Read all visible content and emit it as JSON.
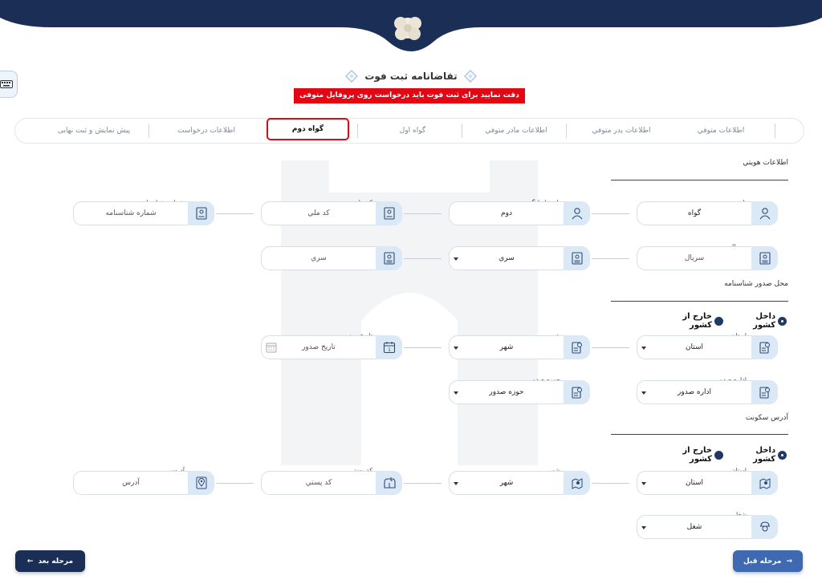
{
  "page": {
    "title": "تقاضانامه ثبت فوت",
    "warning": "دقت نمایید برای ثبت فوت باید درخواست روی پروفایل متوفی تقاضا داده شود"
  },
  "steps": [
    {
      "label": "اطلاعات متوفي"
    },
    {
      "label": "اطلاعات پدر متوفي"
    },
    {
      "label": "اطلاعات مادر متوفي"
    },
    {
      "label": "گواه اول"
    },
    {
      "label": "گواه دوم",
      "active": true
    },
    {
      "label": "اطلاعات درخواست"
    },
    {
      "label": "پیش نمایش و ثبت نهایی"
    }
  ],
  "sections": {
    "identity": "اطلاعات هويتي",
    "issue_place": "محل صدور شناسنامه",
    "residence": "آدرس سکونت"
  },
  "radios": {
    "inside": "داخل کشور",
    "outside": "خارج از کشور"
  },
  "fields": {
    "first_name": {
      "label": "نام",
      "value": "گواه"
    },
    "last_name": {
      "label": "نام خانوادگي",
      "value": "دوم"
    },
    "national_code": {
      "label": "کد ملي",
      "value": "کد ملي"
    },
    "birth_cert_number": {
      "label": "شماره شناسنامه",
      "value": "شماره شناسنامه"
    },
    "serial": {
      "label": "سريال",
      "value": "سريال"
    },
    "series_select": {
      "label": "سري",
      "value": "سري"
    },
    "series": {
      "label": "سري",
      "value": "سري"
    },
    "issue_province": {
      "label": "استان",
      "value": "استان"
    },
    "issue_city": {
      "label": "شهر",
      "value": "شهر"
    },
    "issue_date": {
      "label": "تاريخ صدور",
      "value": "تاريخ صدور"
    },
    "issue_office": {
      "label": "اداره صدور",
      "value": "اداره صدور"
    },
    "issue_zone": {
      "label": "حوزه صدور",
      "value": "حوزه صدور"
    },
    "res_province": {
      "label": "استان",
      "value": "استان"
    },
    "res_city": {
      "label": "شهر",
      "value": "شهر"
    },
    "postal_code": {
      "label": "کد پستي",
      "value": "کد پستي"
    },
    "address": {
      "label": "آدرس",
      "value": "آدرس"
    },
    "job": {
      "label": "شغل",
      "value": "شغل"
    }
  },
  "buttons": {
    "next": "مرحله بعد",
    "prev": "مرحله قبل"
  },
  "colors": {
    "navy": "#1b2f56",
    "accent": "#3f69b1",
    "warning": "#e30613",
    "icon_bg": "#dbe8f6"
  }
}
